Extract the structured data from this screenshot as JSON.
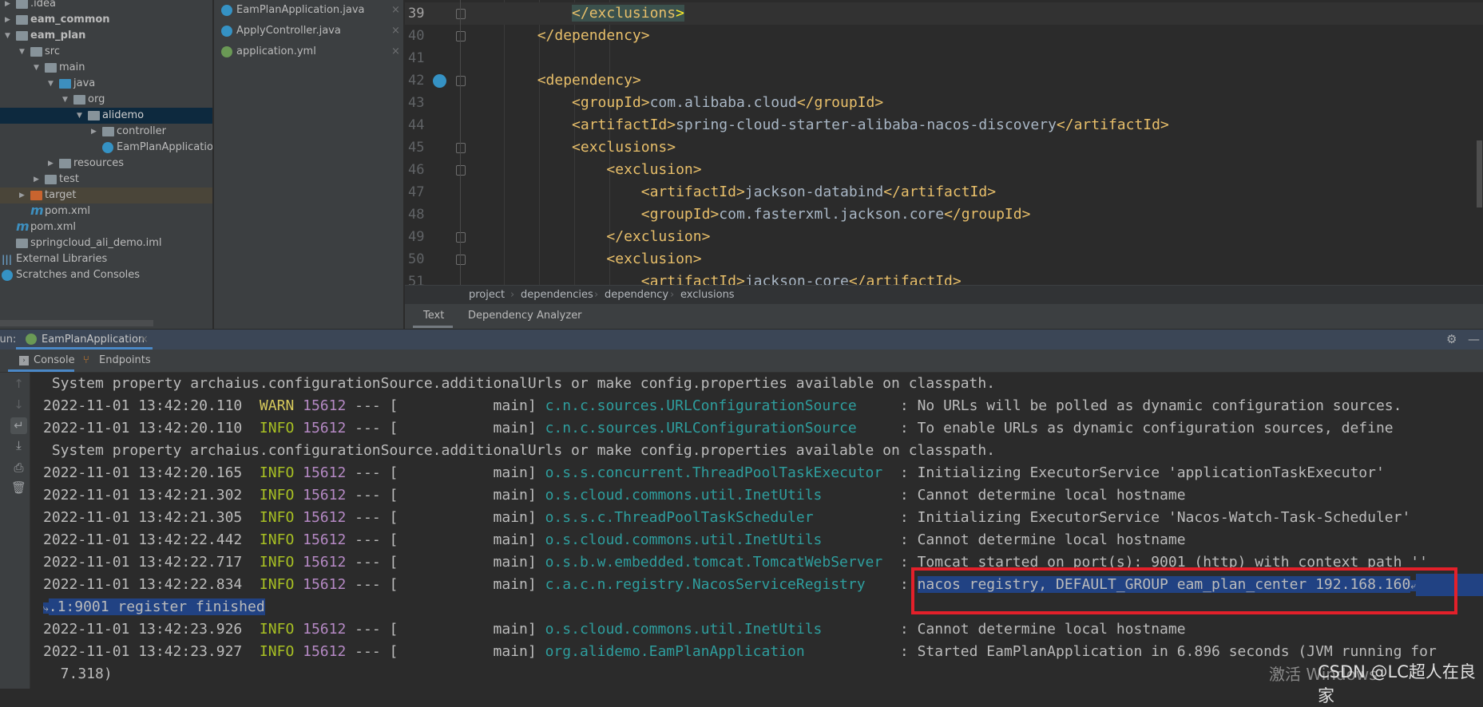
{
  "project_tree": {
    "items": [
      {
        "label": ".idea",
        "depth": 0,
        "icon": "folder",
        "arrow": "collapsed"
      },
      {
        "label": "eam_common",
        "depth": 0,
        "icon": "module-folder",
        "arrow": "collapsed",
        "bold": true
      },
      {
        "label": "eam_plan",
        "depth": 0,
        "icon": "module-folder",
        "arrow": "expanded",
        "bold": true
      },
      {
        "label": "src",
        "depth": 1,
        "icon": "folder",
        "arrow": "expanded"
      },
      {
        "label": "main",
        "depth": 2,
        "icon": "folder",
        "arrow": "expanded"
      },
      {
        "label": "java",
        "depth": 3,
        "icon": "source-folder",
        "arrow": "expanded"
      },
      {
        "label": "org",
        "depth": 4,
        "icon": "package",
        "arrow": "expanded"
      },
      {
        "label": "alidemo",
        "depth": 5,
        "icon": "package",
        "arrow": "expanded",
        "selected": true
      },
      {
        "label": "controller",
        "depth": 6,
        "icon": "package",
        "arrow": "collapsed"
      },
      {
        "label": "EamPlanApplication",
        "depth": 6,
        "icon": "spring-boot-class",
        "arrow": "none"
      },
      {
        "label": "resources",
        "depth": 3,
        "icon": "resources-folder",
        "arrow": "collapsed"
      },
      {
        "label": "test",
        "depth": 2,
        "icon": "folder",
        "arrow": "collapsed"
      },
      {
        "label": "target",
        "depth": 1,
        "icon": "excluded-folder",
        "arrow": "collapsed",
        "highlighted": true
      },
      {
        "label": "pom.xml",
        "depth": 1,
        "icon": "maven",
        "arrow": "none"
      },
      {
        "label": "pom.xml",
        "depth": 0,
        "icon": "maven",
        "arrow": "none"
      },
      {
        "label": "springcloud_ali_demo.iml",
        "depth": 0,
        "icon": "iml-file",
        "arrow": "none"
      },
      {
        "label": "External Libraries",
        "depth": -1,
        "icon": "libraries",
        "arrow": "none"
      },
      {
        "label": "Scratches and Consoles",
        "depth": -1,
        "icon": "scratches",
        "arrow": "none"
      }
    ]
  },
  "open_files": [
    {
      "name": "EamPlanApplication.java",
      "icon": "spring-boot-class",
      "color": "#3592c4"
    },
    {
      "name": "ApplyController.java",
      "icon": "class",
      "color": "#3592c4"
    },
    {
      "name": "application.yml",
      "icon": "spring-config",
      "color": "#6a9955"
    }
  ],
  "editor": {
    "lines": [
      {
        "n": "39",
        "code": "            </exclusions>",
        "current": true,
        "fold": true
      },
      {
        "n": "40",
        "code": "        </dependency>",
        "fold": true
      },
      {
        "n": "41",
        "code": ""
      },
      {
        "n": "42",
        "code": "        <dependency>",
        "fold": true,
        "gutter_icon": "override-icon"
      },
      {
        "n": "43",
        "code": "            <groupId>com.alibaba.cloud</groupId>"
      },
      {
        "n": "44",
        "code": "            <artifactId>spring-cloud-starter-alibaba-nacos-discovery</artifactId>"
      },
      {
        "n": "45",
        "code": "            <exclusions>",
        "fold": true
      },
      {
        "n": "46",
        "code": "                <exclusion>",
        "fold": true
      },
      {
        "n": "47",
        "code": "                    <artifactId>jackson-databind</artifactId>"
      },
      {
        "n": "48",
        "code": "                    <groupId>com.fasterxml.jackson.core</groupId>"
      },
      {
        "n": "49",
        "code": "                </exclusion>",
        "fold": true
      },
      {
        "n": "50",
        "code": "                <exclusion>",
        "fold": true
      },
      {
        "n": "51",
        "code": "                    <artifactId>jackson-core</artifactId>"
      }
    ]
  },
  "breadcrumb": [
    "project",
    "dependencies",
    "dependency",
    "exclusions"
  ],
  "editor_tabs": {
    "text": "Text",
    "analyzer": "Dependency Analyzer"
  },
  "run_panel": {
    "label": "Run:",
    "tab": "EamPlanApplication",
    "console_tab": "Console",
    "endpoints_tab": "Endpoints"
  },
  "console": {
    "lines": [
      {
        "type": "text",
        "text": " System property archaius.configurationSource.additionalUrls or make config.properties available on classpath."
      },
      {
        "type": "log",
        "ts": "2022-11-01 13:42:20.110",
        "level": "WARN",
        "pid": "15612",
        "thread": "main",
        "logger": "c.n.c.sources.URLConfigurationSource",
        "message": "No URLs will be polled as dynamic configuration sources."
      },
      {
        "type": "log",
        "ts": "2022-11-01 13:42:20.110",
        "level": "INFO",
        "pid": "15612",
        "thread": "main",
        "logger": "c.n.c.sources.URLConfigurationSource",
        "message": "To enable URLs as dynamic configuration sources, define"
      },
      {
        "type": "text",
        "text": " System property archaius.configurationSource.additionalUrls or make config.properties available on classpath."
      },
      {
        "type": "log",
        "ts": "2022-11-01 13:42:20.165",
        "level": "INFO",
        "pid": "15612",
        "thread": "main",
        "logger": "o.s.s.concurrent.ThreadPoolTaskExecutor",
        "message": "Initializing ExecutorService 'applicationTaskExecutor'"
      },
      {
        "type": "log",
        "ts": "2022-11-01 13:42:21.302",
        "level": "INFO",
        "pid": "15612",
        "thread": "main",
        "logger": "o.s.cloud.commons.util.InetUtils",
        "message": "Cannot determine local hostname"
      },
      {
        "type": "log",
        "ts": "2022-11-01 13:42:21.305",
        "level": "INFO",
        "pid": "15612",
        "thread": "main",
        "logger": "o.s.s.c.ThreadPoolTaskScheduler",
        "message": "Initializing ExecutorService 'Nacos-Watch-Task-Scheduler'"
      },
      {
        "type": "log",
        "ts": "2022-11-01 13:42:22.442",
        "level": "INFO",
        "pid": "15612",
        "thread": "main",
        "logger": "o.s.cloud.commons.util.InetUtils",
        "message": "Cannot determine local hostname"
      },
      {
        "type": "log",
        "ts": "2022-11-01 13:42:22.717",
        "level": "INFO",
        "pid": "15612",
        "thread": "main",
        "logger": "o.s.b.w.embedded.tomcat.TomcatWebServer",
        "message": "Tomcat started on port(s): 9001 (http) with context path ''"
      },
      {
        "type": "log",
        "ts": "2022-11-01 13:42:22.834",
        "level": "INFO",
        "pid": "15612",
        "thread": "main",
        "logger": "c.a.c.n.registry.NacosServiceRegistry",
        "message": "nacos registry, DEFAULT_GROUP eam_plan_center 192.168.160",
        "selected": true,
        "wrap": true
      },
      {
        "type": "wrapped",
        "text": ".1:9001 register finished",
        "selected": true
      },
      {
        "type": "log",
        "ts": "2022-11-01 13:42:23.926",
        "level": "INFO",
        "pid": "15612",
        "thread": "main",
        "logger": "o.s.cloud.commons.util.InetUtils",
        "message": "Cannot determine local hostname"
      },
      {
        "type": "log",
        "ts": "2022-11-01 13:42:23.927",
        "level": "INFO",
        "pid": "15612",
        "thread": "main",
        "logger": "org.alidemo.EamPlanApplication",
        "message": "Started EamPlanApplication in 6.896 seconds (JVM running for"
      },
      {
        "type": "text",
        "text": "  7.318)"
      }
    ]
  },
  "annotation": {
    "color": "#e3202a"
  },
  "watermark": {
    "windows": "激活 Windows",
    "csdn": "CSDN @LC超人在良家"
  }
}
